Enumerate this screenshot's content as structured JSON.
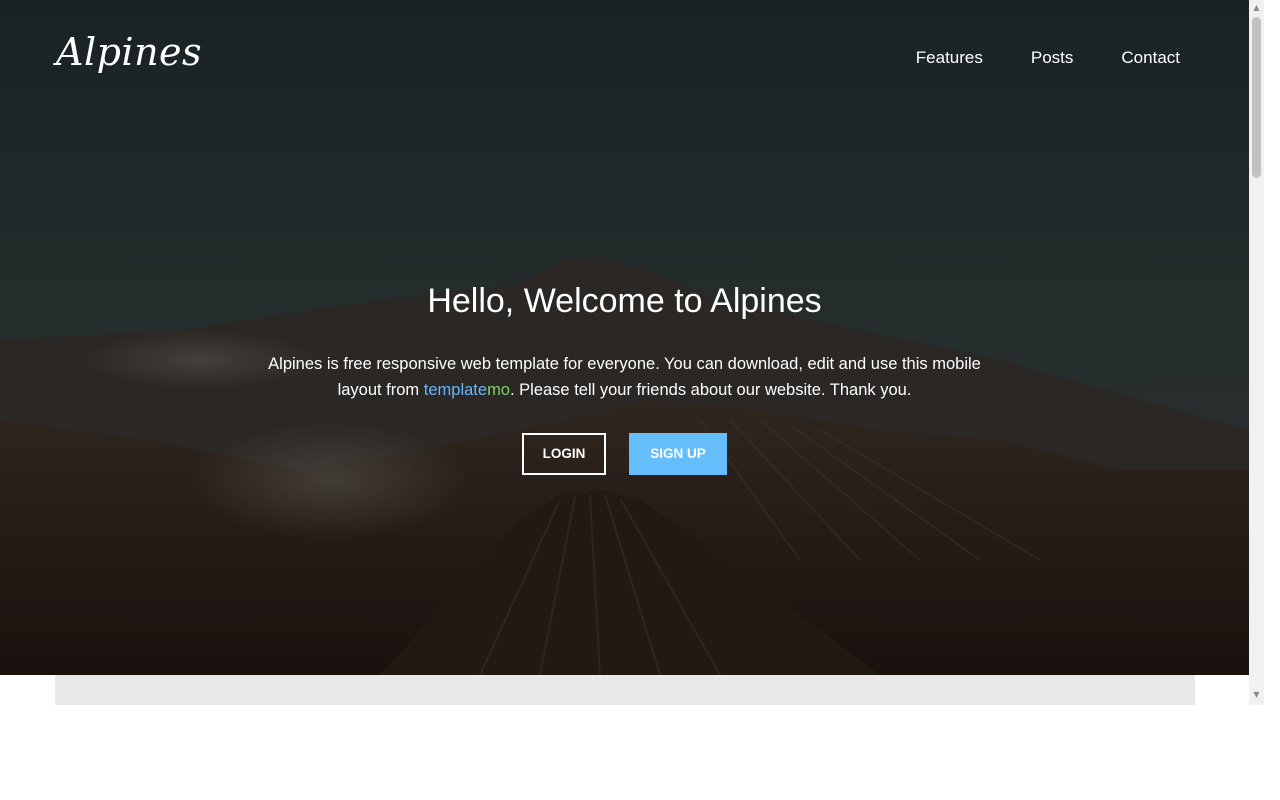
{
  "brand": {
    "logo": "Alpines"
  },
  "nav": {
    "items": [
      {
        "label": "Features"
      },
      {
        "label": "Posts"
      },
      {
        "label": "Contact"
      }
    ]
  },
  "hero": {
    "headline": "Hello, Welcome to Alpines",
    "intro_part1": "Alpines is free responsive web template for everyone. You can download, edit and use this mobile layout from ",
    "link_part_a": "template",
    "link_part_b": "mo",
    "intro_part2": ". Please tell your friends about our website. Thank you.",
    "login_label": "LOGIN",
    "signup_label": "SIGN UP"
  },
  "colors": {
    "signup_button": "#66bdfc",
    "link_blue": "#66b7ff",
    "link_green": "#7bd46a",
    "gray_band": "#e8e8e8"
  },
  "scrollbar": {
    "up_icon": "arrow-up-icon",
    "down_icon": "arrow-down-icon"
  }
}
